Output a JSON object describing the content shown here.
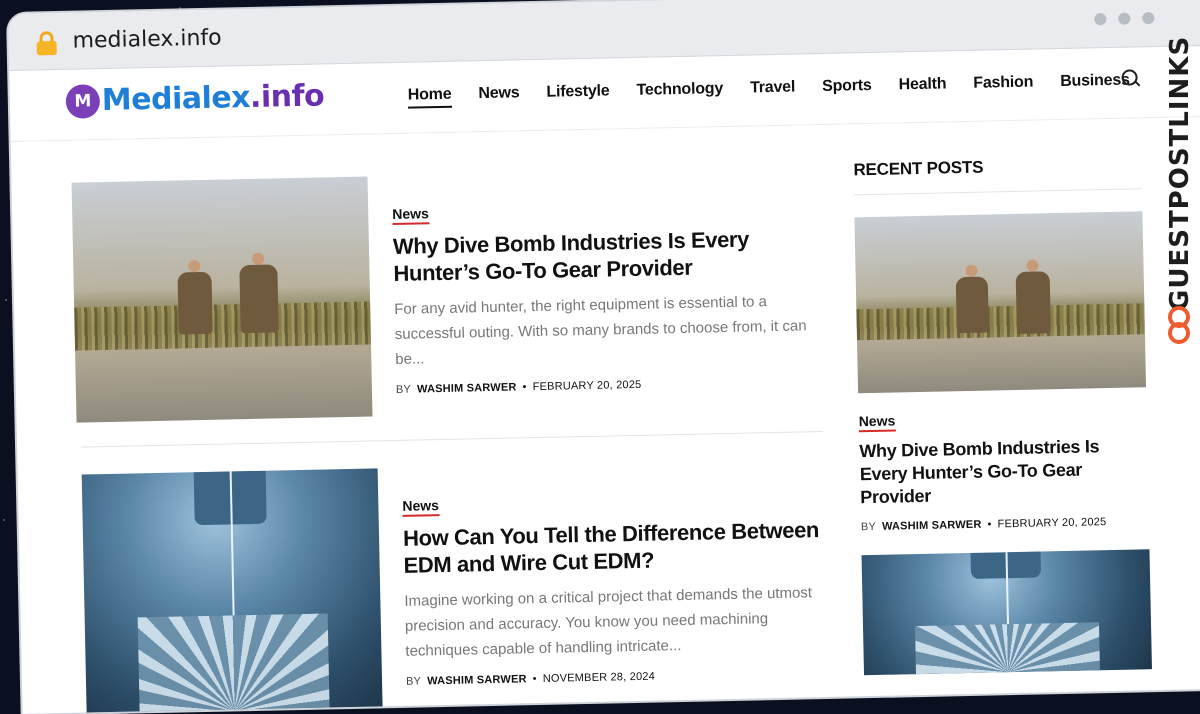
{
  "browser": {
    "url": "medialex.info"
  },
  "logo": {
    "mark": "M",
    "text_a": "Medialex",
    "text_b": ".info"
  },
  "nav": [
    "Home",
    "News",
    "Lifestyle",
    "Technology",
    "Travel",
    "Sports",
    "Health",
    "Fashion",
    "Business"
  ],
  "posts": [
    {
      "category": "News",
      "title": "Why Dive Bomb Industries Is Every Hunter’s Go-To Gear Provider",
      "excerpt": "For any avid hunter, the right equipment is essential to a successful outing. With so many brands to choose from, it can be...",
      "by": "BY",
      "author": "WASHIM SARWER",
      "date": "FEBRUARY 20, 2025"
    },
    {
      "category": "News",
      "title": "How Can You Tell the Difference Between EDM and Wire Cut EDM?",
      "excerpt": "Imagine working on a critical project that demands the utmost precision and accuracy. You know you need machining techniques capable of handling intricate...",
      "by": "BY",
      "author": "WASHIM SARWER",
      "date": "NOVEMBER 28, 2024"
    }
  ],
  "sidebar": {
    "heading": "RECENT POSTS",
    "items": [
      {
        "category": "News",
        "title": "Why Dive Bomb Industries Is Every Hunter’s Go-To Gear Provider",
        "by": "BY",
        "author": "WASHIM SARWER",
        "date": "FEBRUARY 20, 2025"
      }
    ]
  },
  "watermark": {
    "text": "GUESTPOSTLINKS"
  },
  "colors": {
    "accent_underline": "#d62a2a",
    "logo_blue": "#1f7fd6",
    "logo_purple": "#6a2fb0",
    "watermark_link": "#ef5a2e"
  }
}
